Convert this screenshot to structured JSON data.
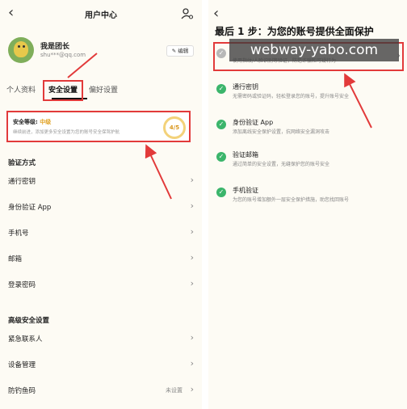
{
  "left": {
    "header": {
      "back_icon": "chevron-left-icon",
      "title": "用户中心",
      "person_settings_icon": "person-settings-icon"
    },
    "profile": {
      "name": "我是团长",
      "email": "shu***@qq.com",
      "edit_label": "编辑",
      "edit_icon": "pencil-icon"
    },
    "tabs": [
      {
        "label": "个人资料"
      },
      {
        "label": "安全设置"
      },
      {
        "label": "偏好设置"
      }
    ],
    "security": {
      "title_prefix": "安全等级:",
      "level": "中级",
      "desc": "继续前进，添加更多安全设置为您的账号安全保驾护航",
      "score": "4/5"
    },
    "verify_section": {
      "title": "验证方式",
      "items": [
        {
          "label": "通行密钥"
        },
        {
          "label": "身份验证 App"
        },
        {
          "label": "手机号"
        },
        {
          "label": "邮箱"
        },
        {
          "label": "登录密码"
        }
      ]
    },
    "advanced_section": {
      "title": "高级安全设置",
      "items": [
        {
          "label": "紧急联系人",
          "value": ""
        },
        {
          "label": "设备管理",
          "value": ""
        },
        {
          "label": "防钓鱼码",
          "value": "未设置"
        }
      ]
    }
  },
  "right": {
    "back_icon": "chevron-left-icon",
    "heading": "最后 1 步：为您的账号提供全面保护",
    "items": [
      {
        "title": "",
        "desc": "使用指纹/人脸识别等验证，防范诈骗和可疑行为",
        "done": false
      },
      {
        "title": "通行密钥",
        "desc": "无需密码或验证码，轻松登录您的账号，提升账号安全",
        "done": true
      },
      {
        "title": "身份验证 App",
        "desc": "添加离线安全保护设置，抗网络安全漏洞攻击",
        "done": true
      },
      {
        "title": "验证邮箱",
        "desc": "通过简单的安全设置，无缝保护您的账号安全",
        "done": true
      },
      {
        "title": "手机验证",
        "desc": "为您的账号增加额外一层安全保护措施，助您找回账号",
        "done": true
      }
    ]
  },
  "watermark": "webway-yabo.com",
  "colors": {
    "highlight": "#e23a3a",
    "check": "#3bb56b",
    "level": "#e0a020"
  }
}
